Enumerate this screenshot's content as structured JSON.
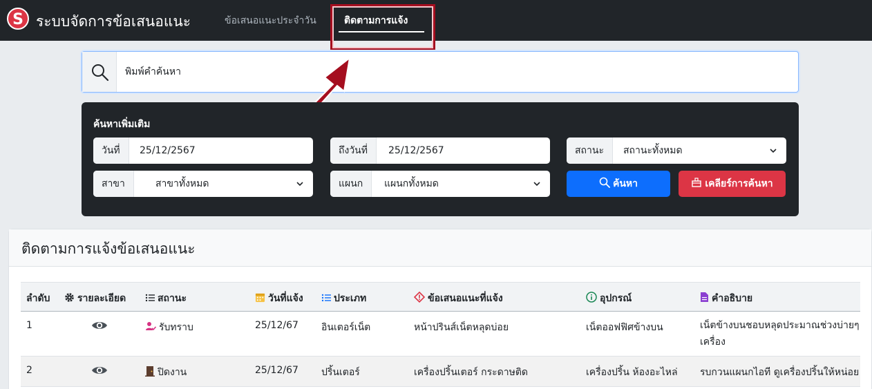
{
  "app": {
    "logo_letter": "S",
    "title": "ระบบจัดการข้อเสนอแนะ"
  },
  "nav": [
    {
      "label": "ข้อเสนอแนะประจำวัน"
    },
    {
      "label": "ติดตามการแจ้ง"
    }
  ],
  "search": {
    "placeholder": "พิมพ์คำค้นหา"
  },
  "advanced": {
    "title": "ค้นหาเพิ่มเติม",
    "date_from_label": "วันที่",
    "date_from_value": "25/12/2567",
    "date_to_label": "ถึงวันที่",
    "date_to_value": "25/12/2567",
    "status_label": "สถานะ",
    "status_value": "สถานะทั้งหมด",
    "branch_label": "สาขา",
    "branch_value": "สาขาทั้งหมด",
    "dept_label": "แผนก",
    "dept_value": "แผนกทั้งหมด",
    "search_button": "ค้นหา",
    "clear_button": "เคลียร์การค้นหา"
  },
  "card": {
    "title": "ติดตามการแจ้งข้อเสนอแนะ"
  },
  "table": {
    "headers": {
      "no": "ลำดับ",
      "detail": "รายละเอียด",
      "status": "สถานะ",
      "date": "วันที่แจ้ง",
      "type": "ประเภท",
      "issue": "ข้อเสนอแนะที่แจ้ง",
      "device": "อุปกรณ์",
      "desc": "คำอธิบาย"
    },
    "rows": [
      {
        "no": "1",
        "status": "รับทราบ",
        "date": "25/12/67",
        "type": "อินเตอร์เน็ต",
        "issue": "หน้าปรินส์เน็ตหลุดบ่อย",
        "device": "เน็ตออฟฟิศข้างบน",
        "desc": "เน็ตข้างบนชอบหลุดประมาณช่วงบ่ายๆ แล้ว ใช้งานเน็ตไม่ได้ทุกเครื่อง"
      },
      {
        "no": "2",
        "status": "ปิดงาน",
        "date": "25/12/67",
        "type": "ปริ้นเตอร์",
        "issue": "เครื่องปริ้นเตอร์ กระดาษติด",
        "device": "เครื่องปริ้น ห้องอะไหล่",
        "desc": "รบกวนแผนกไอที ดูเครื่องปริ้นให้หน่อย"
      }
    ]
  },
  "colors": {
    "navbar": "#212529",
    "primary": "#0d6efd",
    "danger": "#dc3545",
    "highlight": "#a50e1f"
  }
}
